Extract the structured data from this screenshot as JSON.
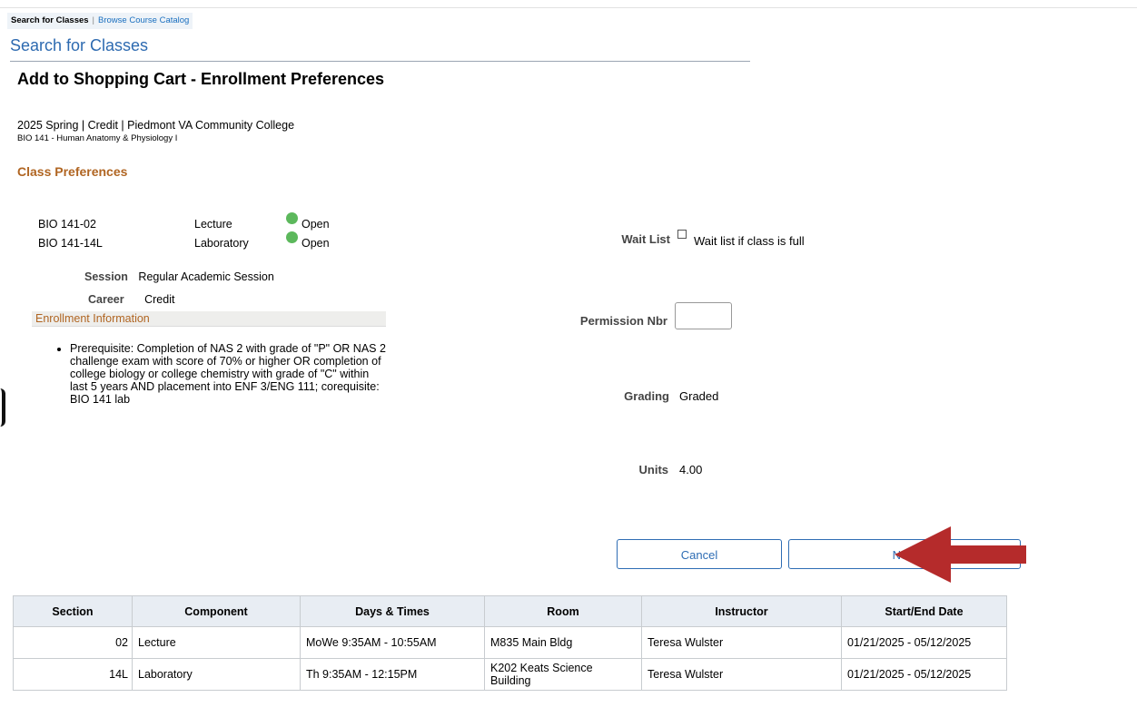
{
  "breadcrumb": {
    "current": "Search for Classes",
    "separator": "|",
    "link": "Browse Course Catalog"
  },
  "page_heading": "Search for Classes",
  "sub_heading": "Add to Shopping Cart - Enrollment Preferences",
  "term_line": "2025 Spring | Credit | Piedmont VA Community College",
  "course_line": "BIO  141 - Human Anatomy & Physiology I",
  "class_prefs": {
    "title": "Class Preferences",
    "classes": [
      {
        "section": "BIO  141-02",
        "component": "Lecture",
        "status": "Open"
      },
      {
        "section": "BIO  141-14L",
        "component": "Laboratory",
        "status": "Open"
      }
    ],
    "status_color": "#5cb85c",
    "session_label": "Session",
    "session_value": "Regular Academic Session",
    "career_label": "Career",
    "career_value": "Credit"
  },
  "enrollment_info": {
    "title": "Enrollment Information",
    "prereq": "Prerequisite: Completion of NAS 2 with grade of \"P\" OR NAS 2 challenge exam with score of 70% or higher OR completion of college biology or college chemistry with grade of \"C\" within last 5 years AND placement into ENF 3/ENG 111; corequisite: BIO 141 lab"
  },
  "form": {
    "wait_list_label": "Wait List",
    "wait_list_text": "Wait list if class is full",
    "wait_list_checked": false,
    "permission_label": "Permission Nbr",
    "permission_value": "",
    "grading_label": "Grading",
    "grading_value": "Graded",
    "units_label": "Units",
    "units_value": "4.00"
  },
  "buttons": {
    "cancel": "Cancel",
    "next": "Next"
  },
  "annotation": {
    "arrow_color": "#b52b2b"
  },
  "table": {
    "headers": [
      "Section",
      "Component",
      "Days & Times",
      "Room",
      "Instructor",
      "Start/End Date"
    ],
    "rows": [
      [
        "02",
        "Lecture",
        "MoWe 9:35AM - 10:55AM",
        "M835 Main Bldg",
        "Teresa Wulster",
        "01/21/2025 - 05/12/2025"
      ],
      [
        "14L",
        "Laboratory",
        "Th 9:35AM - 12:15PM",
        "K202  Keats Science Building",
        "Teresa Wulster",
        "01/21/2025 - 05/12/2025"
      ]
    ]
  }
}
